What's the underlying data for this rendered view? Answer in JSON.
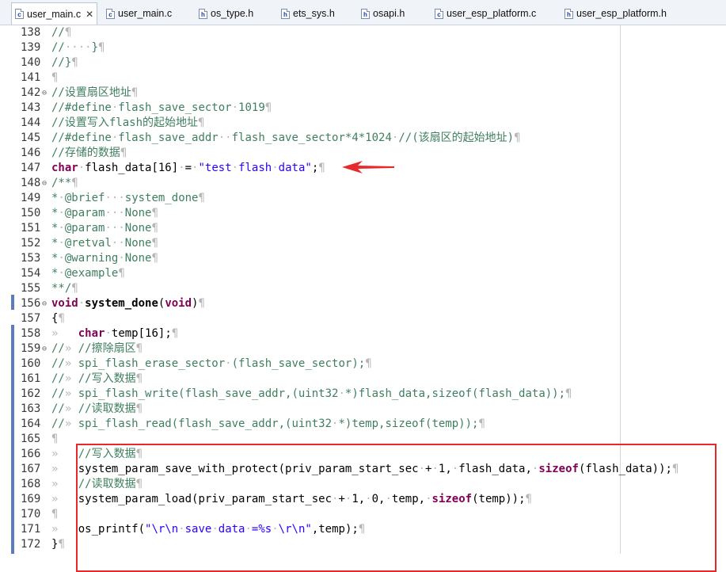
{
  "tabs": [
    {
      "label": "user_main.c",
      "icon": "c-file-icon",
      "glyph": "c",
      "active": true,
      "close": "✕"
    },
    {
      "label": "user_main.c",
      "icon": "c-file-icon",
      "glyph": "c"
    },
    {
      "label": "os_type.h",
      "icon": "h-file-icon",
      "glyph": "h"
    },
    {
      "label": "ets_sys.h",
      "icon": "h-file-icon",
      "glyph": "h"
    },
    {
      "label": "osapi.h",
      "icon": "h-file-icon",
      "glyph": "h"
    },
    {
      "label": "user_esp_platform.c",
      "icon": "c-file-icon",
      "glyph": "c"
    },
    {
      "label": "user_esp_platform.h",
      "icon": "h-file-icon",
      "glyph": "h"
    }
  ],
  "lines": [
    {
      "n": "138",
      "t": "//¶"
    },
    {
      "n": "139",
      "t": "//····}¶"
    },
    {
      "n": "140",
      "t": "//}¶"
    },
    {
      "n": "141",
      "t": "¶"
    },
    {
      "n": "142",
      "t": "//设置扇区地址¶"
    },
    {
      "n": "143",
      "t": "//#define·flash_save_sector·1019¶"
    },
    {
      "n": "144",
      "t": "//设置写入flash的起始地址¶"
    },
    {
      "n": "145",
      "t": "//#define·flash_save_addr··flash_save_sector*4*1024·//(该扇区的起始地址)¶"
    },
    {
      "n": "146",
      "t": "//存储的数据¶"
    },
    {
      "n": "147",
      "t": "char·flash_data[16]·=·\"test·flash·data\";¶"
    },
    {
      "n": "148",
      "t": "/**¶"
    },
    {
      "n": "149",
      "t": "*·@brief···system_done¶"
    },
    {
      "n": "150",
      "t": "*·@param···None¶"
    },
    {
      "n": "151",
      "t": "*·@param···None¶"
    },
    {
      "n": "152",
      "t": "*·@retval··None¶"
    },
    {
      "n": "153",
      "t": "*·@warning·None¶"
    },
    {
      "n": "154",
      "t": "*·@example¶"
    },
    {
      "n": "155",
      "t": "**/¶"
    },
    {
      "n": "156",
      "t": "void·system_done(void)¶"
    },
    {
      "n": "157",
      "t": "{¶"
    },
    {
      "n": "158",
      "t": "»   char·temp[16];¶"
    },
    {
      "n": "159",
      "t": "//» //擦除扇区¶"
    },
    {
      "n": "160",
      "t": "//» spi_flash_erase_sector·(flash_save_sector);¶"
    },
    {
      "n": "161",
      "t": "//» //写入数据¶"
    },
    {
      "n": "162",
      "t": "//» spi_flash_write(flash_save_addr,(uint32·*)flash_data,sizeof(flash_data));¶"
    },
    {
      "n": "163",
      "t": "//» //读取数据¶"
    },
    {
      "n": "164",
      "t": "//» spi_flash_read(flash_save_addr,(uint32·*)temp,sizeof(temp));¶"
    },
    {
      "n": "165",
      "t": "¶"
    },
    {
      "n": "166",
      "t": "»   //写入数据¶"
    },
    {
      "n": "167",
      "t": "»   system_param_save_with_protect(priv_param_start_sec·+·1,·flash_data,·sizeof(flash_data));¶"
    },
    {
      "n": "168",
      "t": "»   //读取数据¶"
    },
    {
      "n": "169",
      "t": "»   system_param_load(priv_param_start_sec·+·1,·0,·temp,·sizeof(temp));¶"
    },
    {
      "n": "170",
      "t": "¶"
    },
    {
      "n": "171",
      "t": "»   os_printf(\"\\r\\n·save·data·=%s·\\r\\n\",temp);¶"
    },
    {
      "n": "172",
      "t": "}¶"
    }
  ],
  "fold_marker": "⊖",
  "colors": {
    "comment": "#3f7f5f",
    "keyword": "#7f0055",
    "string": "#2a00ff",
    "highlight": "#e8292b",
    "change_bar": "#5c7db8"
  }
}
